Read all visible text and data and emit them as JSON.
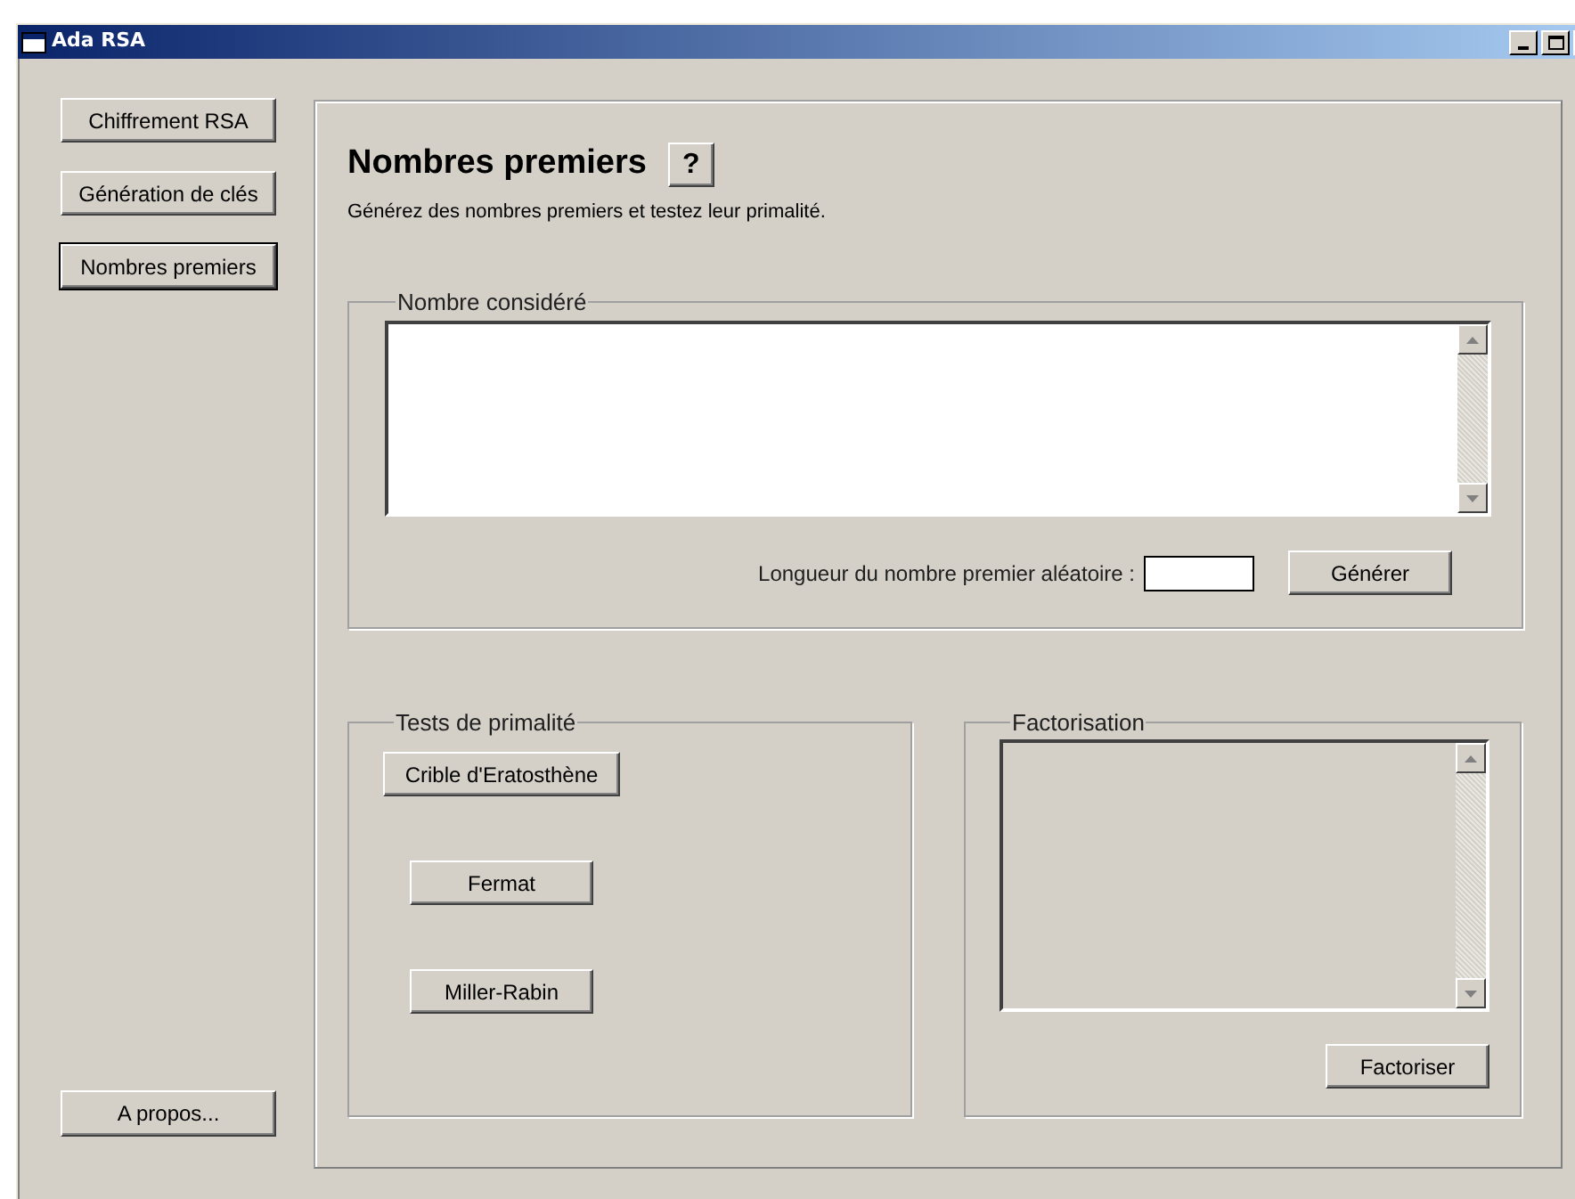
{
  "window": {
    "title": "Ada RSA"
  },
  "sidebar": {
    "items": [
      {
        "label": "Chiffrement RSA",
        "selected": false
      },
      {
        "label": "Génération de clés",
        "selected": false
      },
      {
        "label": "Nombres premiers",
        "selected": true
      }
    ],
    "about_button": "A propos..."
  },
  "page": {
    "title": "Nombres premiers",
    "help_button": "?",
    "subtitle": "Générez des nombres premiers et testez leur primalité."
  },
  "number_group": {
    "title": "Nombre considéré",
    "length_label": "Longueur du nombre premier aléatoire :",
    "generate_button": "Générer"
  },
  "tests_group": {
    "title": "Tests de primalité",
    "buttons": [
      "Crible d'Eratosthène",
      "Fermat",
      "Miller-Rabin"
    ]
  },
  "factor_group": {
    "title": "Factorisation",
    "button": "Factoriser"
  }
}
